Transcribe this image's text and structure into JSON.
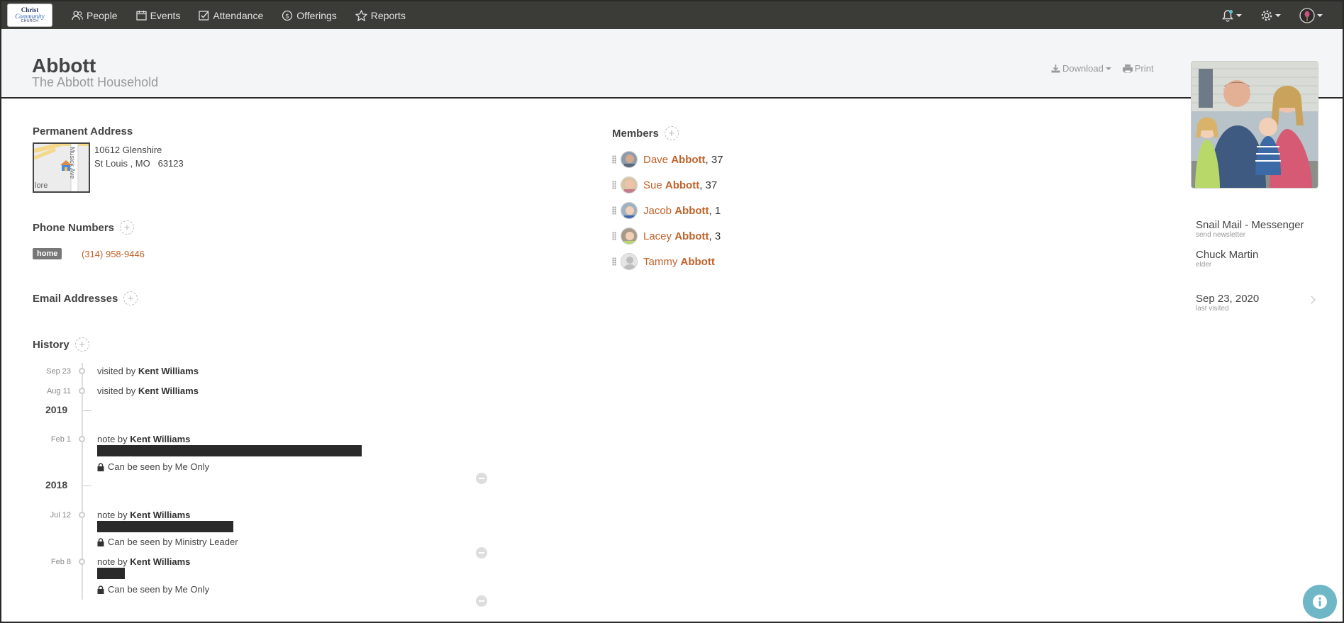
{
  "nav": {
    "logo": {
      "line1": "Christ",
      "line2": "Community",
      "line3": "CHURCH"
    },
    "items": [
      {
        "label": "People",
        "icon": "people-icon"
      },
      {
        "label": "Events",
        "icon": "calendar-icon"
      },
      {
        "label": "Attendance",
        "icon": "checkbox-icon"
      },
      {
        "label": "Offerings",
        "icon": "coin-icon"
      },
      {
        "label": "Reports",
        "icon": "star-icon"
      }
    ]
  },
  "header": {
    "title": "Abbott",
    "subtitle": "The Abbott Household",
    "download_label": "Download",
    "print_label": "Print"
  },
  "address": {
    "title": "Permanent Address",
    "line1": "10612 Glenshire",
    "line2": "St Louis , MO   63123",
    "map_street": "Musick Ave",
    "map_fragment": "lore"
  },
  "phones": {
    "title": "Phone Numbers",
    "items": [
      {
        "type": "home",
        "number": "(314) 958-9446"
      }
    ]
  },
  "emails": {
    "title": "Email Addresses"
  },
  "history": {
    "title": "History",
    "entries": [
      {
        "date": "Sep 23",
        "text": "visited by ",
        "by": "Kent Williams"
      },
      {
        "date": "Aug 11",
        "text": "visited by ",
        "by": "Kent Williams"
      },
      {
        "year": "2019"
      },
      {
        "date": "Feb 1",
        "text": "note by ",
        "by": "Kent Williams",
        "visibility": "Can be seen by Me Only"
      },
      {
        "year": "2018"
      },
      {
        "date": "Jul 12",
        "text": "note by ",
        "by": "Kent Williams",
        "visibility": "Can be seen by Ministry Leader"
      },
      {
        "date": "Feb 8",
        "text": "note by ",
        "by": "Kent Williams",
        "visibility": "Can be seen by Me Only"
      }
    ]
  },
  "members": {
    "title": "Members",
    "items": [
      {
        "first": "Dave",
        "last": "Abbott",
        "age": ", 37"
      },
      {
        "first": "Sue",
        "last": "Abbott",
        "age": ", 37"
      },
      {
        "first": "Jacob",
        "last": "Abbott",
        "age": ", 1"
      },
      {
        "first": "Lacey",
        "last": "Abbott",
        "age": ", 3"
      },
      {
        "first": "Tammy",
        "last": "Abbott",
        "age": ""
      }
    ]
  },
  "info": {
    "mail": {
      "value": "Snail Mail - Messenger",
      "label": "send newsletter"
    },
    "elder": {
      "value": "Chuck Martin",
      "label": "elder"
    },
    "visited": {
      "value": "Sep 23, 2020",
      "label": "last visited"
    }
  },
  "colors": {
    "accent": "#c0622b",
    "nav_bg": "#3b3b37",
    "header_bg": "#f3f5f7",
    "help": "#6fb6c6"
  }
}
